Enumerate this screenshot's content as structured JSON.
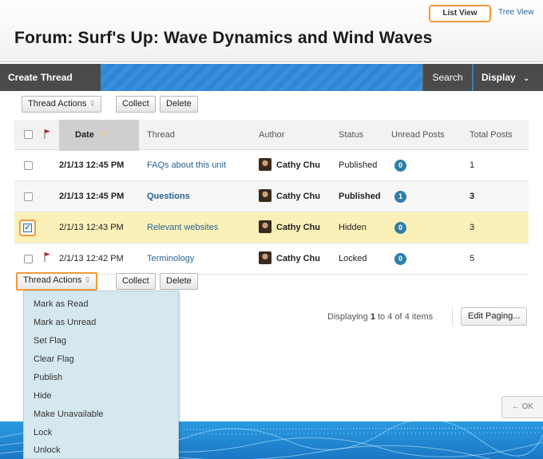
{
  "header": {
    "title": "Forum: Surf's Up: Wave Dynamics and Wind Waves",
    "list_view": "List View",
    "tree_view": "Tree View"
  },
  "action_bar": {
    "create_thread": "Create Thread",
    "search": "Search",
    "display": "Display"
  },
  "toolbar": {
    "thread_actions": "Thread Actions",
    "collect": "Collect",
    "delete": "Delete"
  },
  "table": {
    "columns": {
      "date": "Date",
      "thread": "Thread",
      "author": "Author",
      "status": "Status",
      "unread": "Unread Posts",
      "total": "Total Posts"
    },
    "rows": [
      {
        "date": "2/1/13 12:45 PM",
        "thread": "FAQs about this unit",
        "author": "Cathy Chu",
        "status": "Published",
        "unread": "0",
        "total": "1"
      },
      {
        "date": "2/1/13 12:45 PM",
        "thread": "Questions",
        "author": "Cathy Chu",
        "status": "Published",
        "unread": "1",
        "total": "3"
      },
      {
        "date": "2/1/13 12:43 PM",
        "thread": "Relevant websites",
        "author": "Cathy Chu",
        "status": "Hidden",
        "unread": "0",
        "total": "3"
      },
      {
        "date": "2/1/13 12:42 PM",
        "thread": "Terminology",
        "author": "Cathy Chu",
        "status": "Locked",
        "unread": "0",
        "total": "5"
      }
    ]
  },
  "dropdown": {
    "items": [
      "Mark as Read",
      "Mark as Unread",
      "Set Flag",
      "Clear Flag",
      "Publish",
      "Hide",
      "Make Unavailable",
      "Lock",
      "Unlock"
    ]
  },
  "paging": {
    "prefix": "Displaying",
    "from": "1",
    "to_word": "to",
    "to": "4",
    "of_word": "of",
    "total": "4",
    "suffix": "items",
    "edit": "Edit Paging..."
  },
  "footer": {
    "ok": "OK"
  },
  "colors": {
    "accent_orange": "#f29a3a",
    "bar_blue": "#2f86d6",
    "selected_row": "#fbf1b8",
    "badge": "#2e7fa8",
    "menu_bg": "#d6e8ef"
  }
}
